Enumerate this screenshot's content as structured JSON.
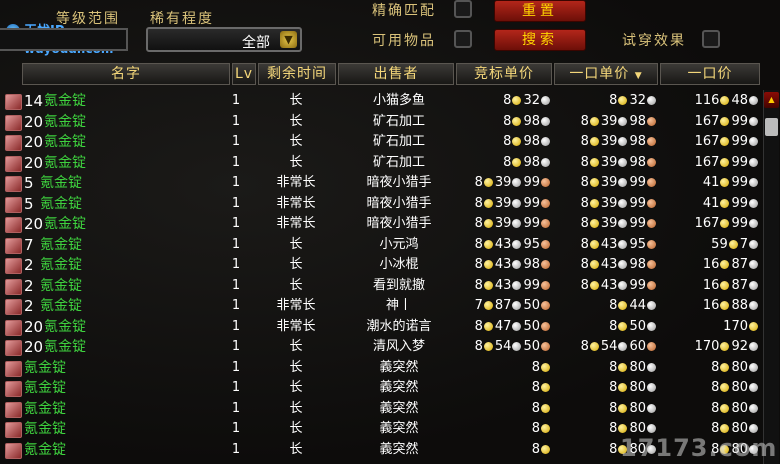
{
  "top": {
    "level_range_label": "等级范围",
    "rarity_label": "稀有程度",
    "rarity_value": "全部",
    "exact_match_label": "精确匹配",
    "usable_items_label": "可用物品",
    "try_on_label": "试穿效果",
    "reset_label": "重置",
    "search_label": "搜索"
  },
  "watermark": {
    "brand": "无忧IP",
    "url": "wuyoudl.com",
    "site": "17173.com"
  },
  "columns": {
    "name": "名字",
    "lv": "Lv",
    "time_left": "剩余时间",
    "seller": "出售者",
    "bid_unit_price": "竞标单价",
    "buyout_unit_price": "一口单价",
    "buyout_price": "一口价"
  },
  "rows": [
    {
      "count": "14",
      "name": "氪金锭",
      "lv": "1",
      "time": "长",
      "seller": "小猫多鱼",
      "bid": {
        "g": "8",
        "s": "32",
        "c": ""
      },
      "unit": {
        "g": "8",
        "s": "32",
        "c": ""
      },
      "buyout": {
        "g": "116",
        "s": "48",
        "c": ""
      }
    },
    {
      "count": "20",
      "name": "氪金锭",
      "lv": "1",
      "time": "长",
      "seller": "矿石加工",
      "bid": {
        "g": "8",
        "s": "98",
        "c": ""
      },
      "unit": {
        "g": "8",
        "s": "39",
        "c": "98"
      },
      "buyout": {
        "g": "167",
        "s": "99",
        "c": ""
      }
    },
    {
      "count": "20",
      "name": "氪金锭",
      "lv": "1",
      "time": "长",
      "seller": "矿石加工",
      "bid": {
        "g": "8",
        "s": "98",
        "c": ""
      },
      "unit": {
        "g": "8",
        "s": "39",
        "c": "98"
      },
      "buyout": {
        "g": "167",
        "s": "99",
        "c": ""
      }
    },
    {
      "count": "20",
      "name": "氪金锭",
      "lv": "1",
      "time": "长",
      "seller": "矿石加工",
      "bid": {
        "g": "8",
        "s": "98",
        "c": ""
      },
      "unit": {
        "g": "8",
        "s": "39",
        "c": "98"
      },
      "buyout": {
        "g": "167",
        "s": "99",
        "c": ""
      }
    },
    {
      "count": "5",
      "name": "氪金锭",
      "lv": "1",
      "time": "非常长",
      "seller": "暗夜小猎手",
      "bid": {
        "g": "8",
        "s": "39",
        "c": "99"
      },
      "unit": {
        "g": "8",
        "s": "39",
        "c": "99"
      },
      "buyout": {
        "g": "41",
        "s": "99",
        "c": ""
      }
    },
    {
      "count": "5",
      "name": "氪金锭",
      "lv": "1",
      "time": "非常长",
      "seller": "暗夜小猎手",
      "bid": {
        "g": "8",
        "s": "39",
        "c": "99"
      },
      "unit": {
        "g": "8",
        "s": "39",
        "c": "99"
      },
      "buyout": {
        "g": "41",
        "s": "99",
        "c": ""
      }
    },
    {
      "count": "20",
      "name": "氪金锭",
      "lv": "1",
      "time": "非常长",
      "seller": "暗夜小猎手",
      "bid": {
        "g": "8",
        "s": "39",
        "c": "99"
      },
      "unit": {
        "g": "8",
        "s": "39",
        "c": "99"
      },
      "buyout": {
        "g": "167",
        "s": "99",
        "c": ""
      }
    },
    {
      "count": "7",
      "name": "氪金锭",
      "lv": "1",
      "time": "长",
      "seller": "小元鸿",
      "bid": {
        "g": "8",
        "s": "43",
        "c": "95"
      },
      "unit": {
        "g": "8",
        "s": "43",
        "c": "95"
      },
      "buyout": {
        "g": "59",
        "s": "7",
        "c": ""
      }
    },
    {
      "count": "2",
      "name": "氪金锭",
      "lv": "1",
      "time": "长",
      "seller": "小冰棍",
      "bid": {
        "g": "8",
        "s": "43",
        "c": "98"
      },
      "unit": {
        "g": "8",
        "s": "43",
        "c": "98"
      },
      "buyout": {
        "g": "16",
        "s": "87",
        "c": ""
      }
    },
    {
      "count": "2",
      "name": "氪金锭",
      "lv": "1",
      "time": "长",
      "seller": "看到就撤",
      "bid": {
        "g": "8",
        "s": "43",
        "c": "99"
      },
      "unit": {
        "g": "8",
        "s": "43",
        "c": "99"
      },
      "buyout": {
        "g": "16",
        "s": "87",
        "c": ""
      }
    },
    {
      "count": "2",
      "name": "氪金锭",
      "lv": "1",
      "time": "非常长",
      "seller": "神丨",
      "bid": {
        "g": "7",
        "s": "87",
        "c": "50"
      },
      "unit": {
        "g": "8",
        "s": "44",
        "c": ""
      },
      "buyout": {
        "g": "16",
        "s": "88",
        "c": ""
      }
    },
    {
      "count": "20",
      "name": "氪金锭",
      "lv": "1",
      "time": "非常长",
      "seller": "潮水的诺言",
      "bid": {
        "g": "8",
        "s": "47",
        "c": "50"
      },
      "unit": {
        "g": "8",
        "s": "50",
        "c": ""
      },
      "buyout": {
        "g": "170",
        "s": "",
        "c": ""
      }
    },
    {
      "count": "20",
      "name": "氪金锭",
      "lv": "1",
      "time": "长",
      "seller": "清风入梦",
      "bid": {
        "g": "8",
        "s": "54",
        "c": "50"
      },
      "unit": {
        "g": "8",
        "s": "54",
        "c": "60"
      },
      "buyout": {
        "g": "170",
        "s": "92",
        "c": ""
      }
    },
    {
      "count": "",
      "name": "氪金锭",
      "lv": "1",
      "time": "长",
      "seller": "義突然",
      "bid": {
        "g": "8",
        "s": "",
        "c": ""
      },
      "unit": {
        "g": "8",
        "s": "80",
        "c": ""
      },
      "buyout": {
        "g": "8",
        "s": "80",
        "c": ""
      }
    },
    {
      "count": "",
      "name": "氪金锭",
      "lv": "1",
      "time": "长",
      "seller": "義突然",
      "bid": {
        "g": "8",
        "s": "",
        "c": ""
      },
      "unit": {
        "g": "8",
        "s": "80",
        "c": ""
      },
      "buyout": {
        "g": "8",
        "s": "80",
        "c": ""
      }
    },
    {
      "count": "",
      "name": "氪金锭",
      "lv": "1",
      "time": "长",
      "seller": "義突然",
      "bid": {
        "g": "8",
        "s": "",
        "c": ""
      },
      "unit": {
        "g": "8",
        "s": "80",
        "c": ""
      },
      "buyout": {
        "g": "8",
        "s": "80",
        "c": ""
      }
    },
    {
      "count": "",
      "name": "氪金锭",
      "lv": "1",
      "time": "长",
      "seller": "義突然",
      "bid": {
        "g": "8",
        "s": "",
        "c": ""
      },
      "unit": {
        "g": "8",
        "s": "80",
        "c": ""
      },
      "buyout": {
        "g": "8",
        "s": "80",
        "c": ""
      }
    },
    {
      "count": "",
      "name": "氪金锭",
      "lv": "1",
      "time": "长",
      "seller": "義突然",
      "bid": {
        "g": "8",
        "s": "",
        "c": ""
      },
      "unit": {
        "g": "8",
        "s": "80",
        "c": ""
      },
      "buyout": {
        "g": "8",
        "s": "80",
        "c": ""
      }
    }
  ],
  "colors": {
    "header_text": "#f4d77a",
    "item_name": "#3ed13e",
    "button_text": "#ffd600",
    "button_bg": "#b3261a"
  }
}
